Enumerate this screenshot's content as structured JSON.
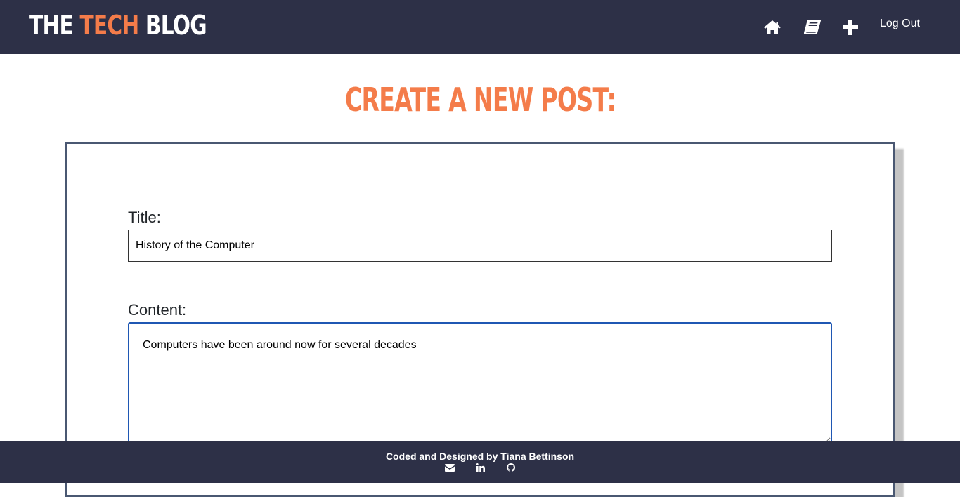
{
  "brand": {
    "part1": "THE ",
    "part2": "TECH",
    "part3": " BLOG"
  },
  "nav": {
    "home_icon": "home-icon",
    "dashboard_icon": "book-icon",
    "new_post_icon": "plus-icon",
    "logout_label": "Log Out"
  },
  "page": {
    "heading": "CREATE A NEW POST:"
  },
  "form": {
    "title_label": "Title:",
    "title_value": "History of the Computer",
    "content_label": "Content:",
    "content_value": "Computers have been around now for several decades"
  },
  "footer": {
    "text": "Coded and Designed by Tiana Bettinson",
    "icons": [
      "envelope-icon",
      "linkedin-icon",
      "github-icon"
    ]
  },
  "colors": {
    "navbar_bg": "#2d3047",
    "accent": "#f47c4a",
    "card_border": "#4a5872",
    "focus_border": "#1f57b3"
  }
}
